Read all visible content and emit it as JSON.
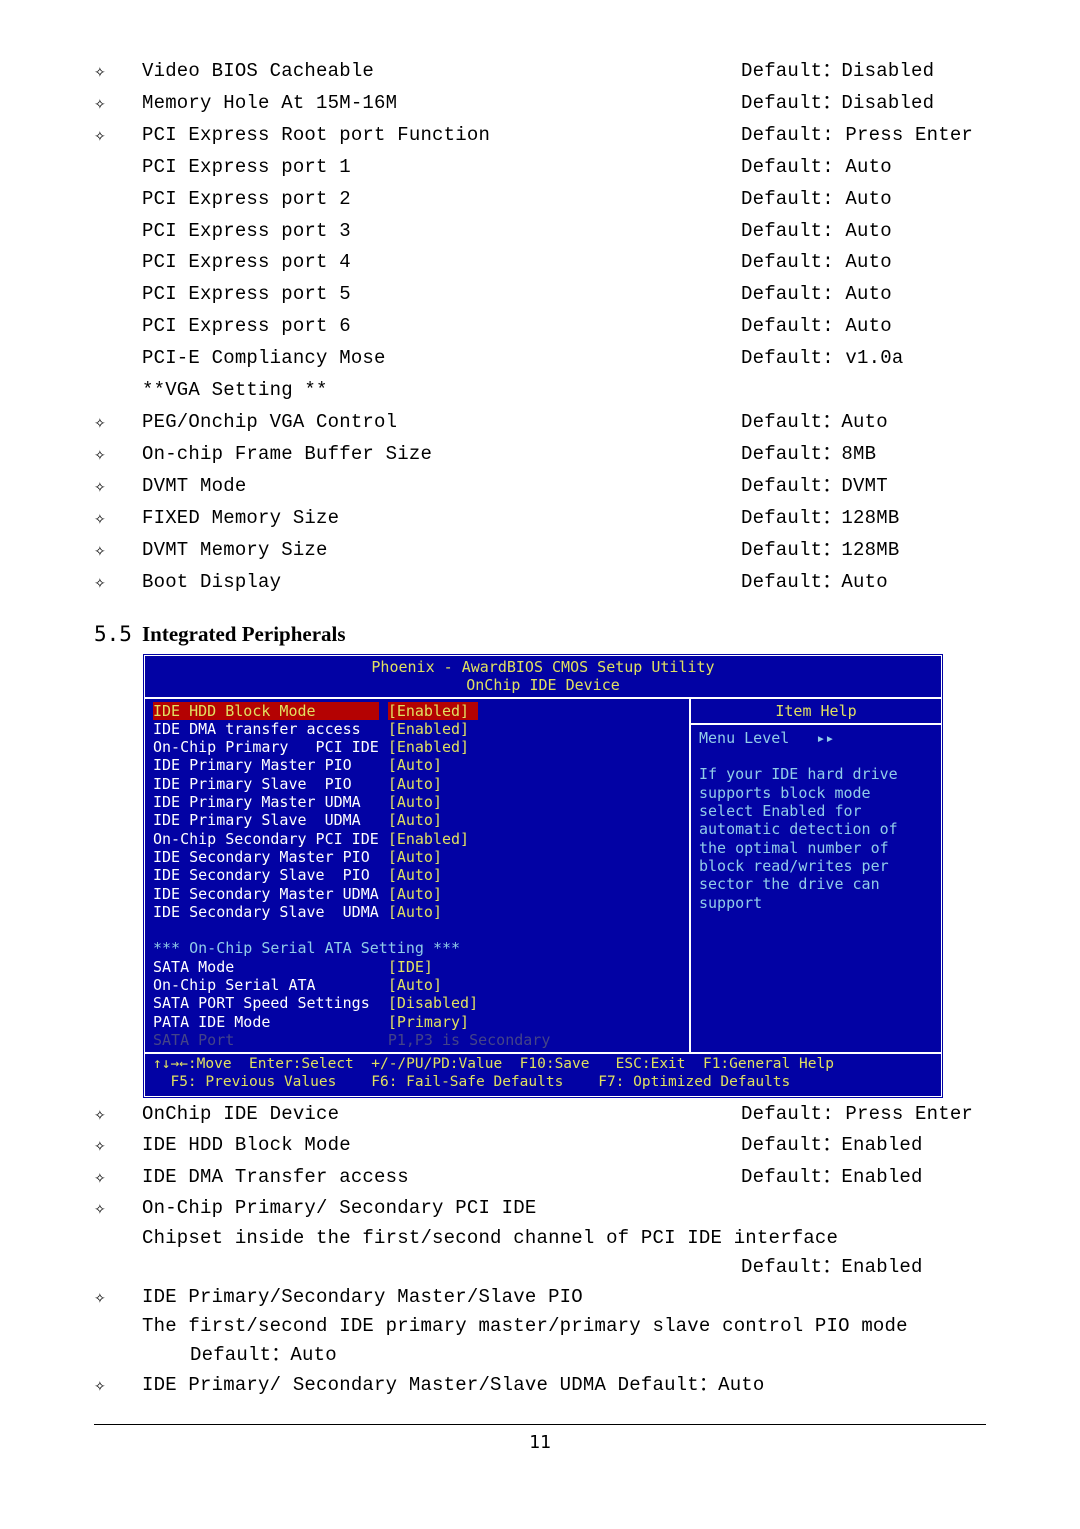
{
  "items_top": [
    {
      "bullet": "✧",
      "label": "Video BIOS Cacheable",
      "value": "Default：Disabled"
    },
    {
      "bullet": "✧",
      "label": "Memory Hole At 15M-16M",
      "value": "Default：Disabled"
    },
    {
      "bullet": "✧",
      "label": "PCI Express Root port Function",
      "value": " Default: Press Enter"
    },
    {
      "bullet": "",
      "label": "PCI Express port 1",
      "value": "Default: Auto"
    },
    {
      "bullet": "",
      "label": "PCI Express port 2",
      "value": "Default: Auto"
    },
    {
      "bullet": "",
      "label": "PCI Express port 3",
      "value": "Default: Auto"
    },
    {
      "bullet": "",
      "label": "PCI Express port 4",
      "value": "Default: Auto"
    },
    {
      "bullet": "",
      "label": "PCI Express port 5",
      "value": "Default: Auto"
    },
    {
      "bullet": "",
      "label": "PCI Express port 6",
      "value": "Default: Auto"
    },
    {
      "bullet": "",
      "label": "PCI-E Compliancy Mose",
      "value": "Default: v1.0a"
    },
    {
      "bullet": "",
      "label": "**VGA Setting **",
      "value": ""
    },
    {
      "bullet": "✧",
      "label": "PEG/Onchip VGA Control",
      "value": "Default：Auto"
    },
    {
      "bullet": "✧",
      "label": "On-chip Frame Buffer Size",
      "value": " Default：8MB"
    },
    {
      "bullet": "✧",
      "label": "DVMT Mode",
      "value": "Default：DVMT"
    },
    {
      "bullet": "✧",
      "label": "FIXED Memory Size",
      "value": " Default：128MB"
    },
    {
      "bullet": "✧",
      "label": "DVMT Memory Size",
      "value": " Default：128MB"
    },
    {
      "bullet": "✧",
      "label": "Boot Display",
      "value": " Default：Auto"
    }
  ],
  "section": {
    "num": "5.5",
    "title": "Integrated Peripherals"
  },
  "bios": {
    "title_line1": "Phoenix - AwardBIOS CMOS Setup Utility",
    "title_line2": "OnChip IDE Device",
    "help_header": "Item Help",
    "help_level": "Menu Level   ▸▸",
    "help_text": "If your IDE hard drive supports block mode select Enabled for automatic detection of the optimal number of block read/writes per sector the drive can support",
    "left_lines": [
      {
        "cls": "h",
        "l": "IDE HDD Block Mode       ",
        "v": "[Enabled] "
      },
      {
        "cls": "",
        "l": "IDE DMA transfer access  ",
        "v": "[Enabled]"
      },
      {
        "cls": "",
        "l": "On-Chip Primary   PCI IDE",
        "v": "[Enabled]"
      },
      {
        "cls": "",
        "l": "IDE Primary Master PIO   ",
        "v": "[Auto]"
      },
      {
        "cls": "",
        "l": "IDE Primary Slave  PIO   ",
        "v": "[Auto]"
      },
      {
        "cls": "",
        "l": "IDE Primary Master UDMA  ",
        "v": "[Auto]"
      },
      {
        "cls": "",
        "l": "IDE Primary Slave  UDMA  ",
        "v": "[Auto]"
      },
      {
        "cls": "",
        "l": "On-Chip Secondary PCI IDE",
        "v": "[Enabled]"
      },
      {
        "cls": "",
        "l": "IDE Secondary Master PIO ",
        "v": "[Auto]"
      },
      {
        "cls": "",
        "l": "IDE Secondary Slave  PIO ",
        "v": "[Auto]"
      },
      {
        "cls": "",
        "l": "IDE Secondary Master UDMA",
        "v": "[Auto]"
      },
      {
        "cls": "",
        "l": "IDE Secondary Slave  UDMA",
        "v": "[Auto]"
      }
    ],
    "sata_header": "*** On-Chip Serial ATA Setting ***",
    "sata_lines": [
      {
        "l": "SATA Mode                ",
        "v": "[IDE]",
        "dim": false
      },
      {
        "l": "On-Chip Serial ATA       ",
        "v": "[Auto]",
        "dim": false
      },
      {
        "l": "SATA PORT Speed Settings ",
        "v": "[Disabled]",
        "dim": false
      },
      {
        "l": "PATA IDE Mode            ",
        "v": "[Primary]",
        "dim": false
      },
      {
        "l": "SATA Port                ",
        "v": "P1,P3 is Secondary",
        "dim": true
      }
    ],
    "footer1": "↑↓→←:Move  Enter:Select  +/-/PU/PD:Value  F10:Save   ESC:Exit  F1:General Help",
    "footer2": "  F5: Previous Values    F6: Fail-Safe Defaults    F7: Optimized Defaults"
  },
  "items_bottom": [
    {
      "bullet": "✧",
      "label": "OnChip IDE Device",
      "value": "Default: Press Enter"
    },
    {
      "bullet": "✧",
      "label": "IDE HDD Block Mode",
      "value": "Default：Enabled"
    },
    {
      "bullet": "✧",
      "label": "IDE DMA Transfer access",
      "value": "Default：Enabled"
    }
  ],
  "pci_ide": {
    "bullet": "✧",
    "line1": "On-Chip Primary/ Secondary PCI IDE",
    "line2": "Chipset inside the first/second channel of PCI IDE interface",
    "line3": "Default：Enabled"
  },
  "pio": {
    "bullet": "✧",
    "line1": "IDE Primary/Secondary Master/Slave PIO",
    "line2": "The first/second IDE primary master/primary slave control PIO mode",
    "line3": "Default：Auto"
  },
  "udma": {
    "bullet": "✧",
    "line": "IDE Primary/ Secondary Master/Slave UDMA   Default：Auto"
  },
  "page": "11"
}
